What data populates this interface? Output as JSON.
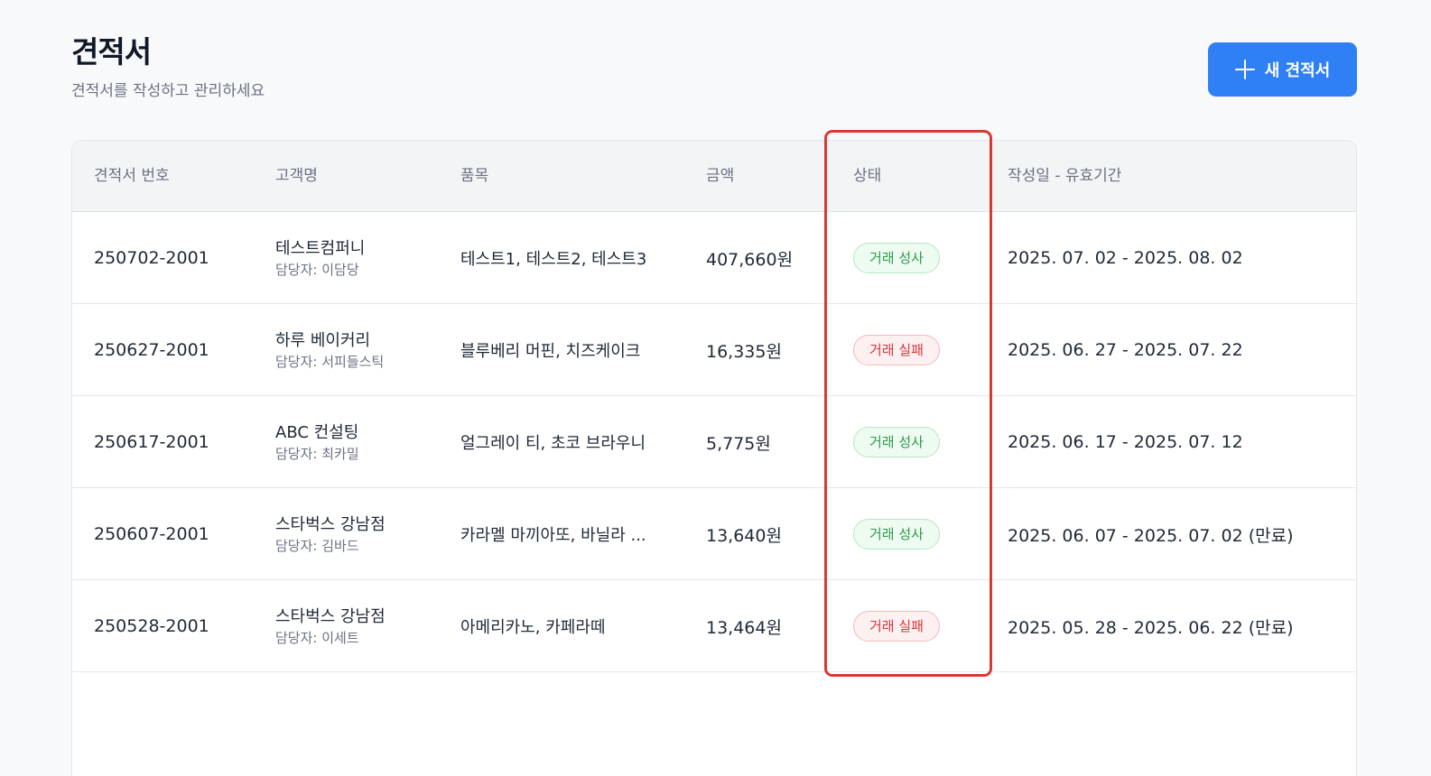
{
  "header": {
    "title": "견적서",
    "subtitle": "견적서를 작성하고 관리하세요",
    "new_button_label": "새 견적서"
  },
  "table": {
    "columns": [
      "견적서 번호",
      "고객명",
      "품목",
      "금액",
      "상태",
      "작성일 - 유효기간"
    ],
    "rows": [
      {
        "id": "250702-2001",
        "customer": "테스트컴퍼니",
        "manager": "담당자: 이담당",
        "items": "테스트1, 테스트2, 테스트3",
        "amount": "407,660원",
        "status": "거래 성사",
        "status_type": "success",
        "date": "2025. 07. 02 - 2025. 08. 02"
      },
      {
        "id": "250627-2001",
        "customer": "하루 베이커리",
        "manager": "담당자: 서피들스틱",
        "items": "블루베리 머핀, 치즈케이크",
        "amount": "16,335원",
        "status": "거래 실패",
        "status_type": "fail",
        "date": "2025. 06. 27 - 2025. 07. 22"
      },
      {
        "id": "250617-2001",
        "customer": "ABC 컨설팅",
        "manager": "담당자: 최카밀",
        "items": "얼그레이 티, 초코 브라우니",
        "amount": "5,775원",
        "status": "거래 성사",
        "status_type": "success",
        "date": "2025. 06. 17 - 2025. 07. 12"
      },
      {
        "id": "250607-2001",
        "customer": "스타벅스 강남점",
        "manager": "담당자: 김바드",
        "items": "카라멜 마끼아또, 바닐라 ...",
        "amount": "13,640원",
        "status": "거래 성사",
        "status_type": "success",
        "date": "2025. 06. 07 - 2025. 07. 02 (만료)"
      },
      {
        "id": "250528-2001",
        "customer": "스타벅스 강남점",
        "manager": "담당자: 이세트",
        "items": "아메리카노, 카페라떼",
        "amount": "13,464원",
        "status": "거래 실패",
        "status_type": "fail",
        "date": "2025. 05. 28 - 2025. 06. 22 (만료)"
      }
    ]
  },
  "colors": {
    "primary": "#2f80f5",
    "success_text": "#2e9a4e",
    "fail_text": "#d9363e",
    "highlight": "#d63b33"
  }
}
